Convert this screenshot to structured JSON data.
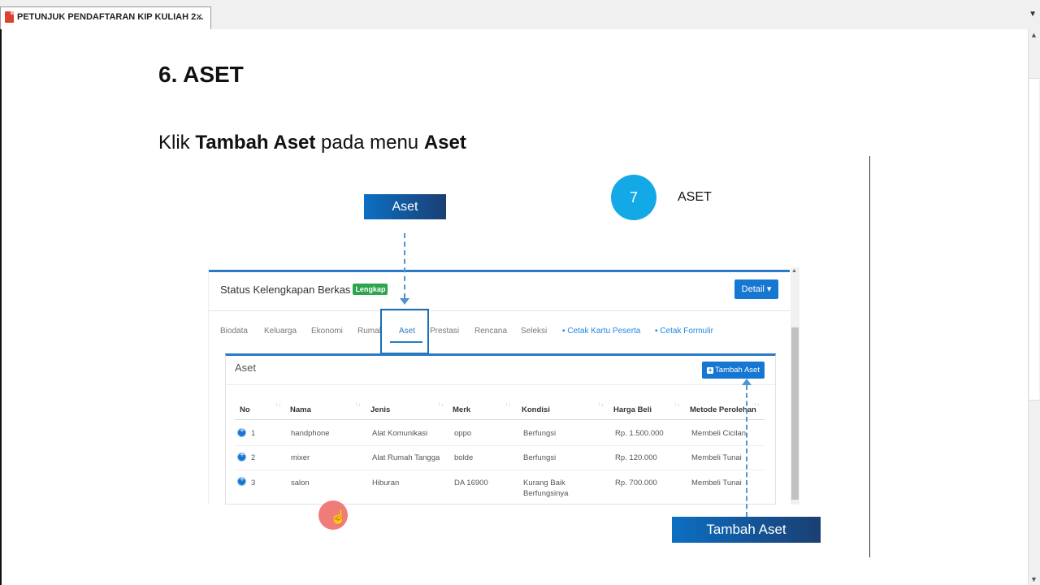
{
  "tab": {
    "title": "PETUNJUK PENDAFTARAN KIP KULIAH 2...",
    "close": "×",
    "menu": "▼"
  },
  "page": {
    "heading": "6. ASET",
    "instruction": {
      "t1": "Klik ",
      "b1": "Tambah Aset",
      "t2": " pada menu ",
      "b2": "Aset"
    }
  },
  "callouts": {
    "aset_label": "Aset",
    "tambah_label": "Tambah Aset",
    "step_number": "7",
    "step_title": "ASET"
  },
  "screenshot": {
    "status_text": "Status Kelengkapan Berkas",
    "status_badge": "Lengkap",
    "detail_button": "Detail ▾",
    "tabs": [
      "Biodata",
      "Keluarga",
      "Ekonomi",
      "Rumah",
      "Aset",
      "Prestasi",
      "Rencana",
      "Seleksi",
      "Cetak Kartu Peserta",
      "Cetak Formulir"
    ],
    "panel_title": "Aset",
    "tambah_button": "Tambah Aset",
    "columns": [
      "No",
      "Nama",
      "Jenis",
      "Merk",
      "Kondisi",
      "Harga Beli",
      "Metode Perolehan"
    ],
    "rows": [
      {
        "no": "1",
        "nama": "handphone",
        "jenis": "Alat Komunikasi",
        "merk": "oppo",
        "kondisi": "Berfungsi",
        "kondisi2": "",
        "harga": "Rp. 1.500.000",
        "metode": "Membeli Cicilan"
      },
      {
        "no": "2",
        "nama": "mixer",
        "jenis": "Alat Rumah Tangga",
        "merk": "bolde",
        "kondisi": "Berfungsi",
        "kondisi2": "",
        "harga": "Rp. 120.000",
        "metode": "Membeli Tunai"
      },
      {
        "no": "3",
        "nama": "salon",
        "jenis": "Hiburan",
        "merk": "DA 16900",
        "kondisi": "Kurang Baik",
        "kondisi2": "Berfungsinya",
        "harga": "Rp. 700.000",
        "metode": "Membeli Tunai"
      }
    ]
  },
  "colors": {
    "accent": "#1677d2",
    "label_gradient_start": "#0c6fc2",
    "label_gradient_end": "#1b3f73",
    "step_circle": "#13a9e6",
    "badge_green": "#2da44e",
    "cursor_highlight": "#f07b7b"
  },
  "icons": [
    "pdf-file-icon",
    "close-icon",
    "chevron-down-icon",
    "file-icon",
    "plus-square-icon",
    "plus-circle-icon",
    "hand-cursor-icon"
  ]
}
